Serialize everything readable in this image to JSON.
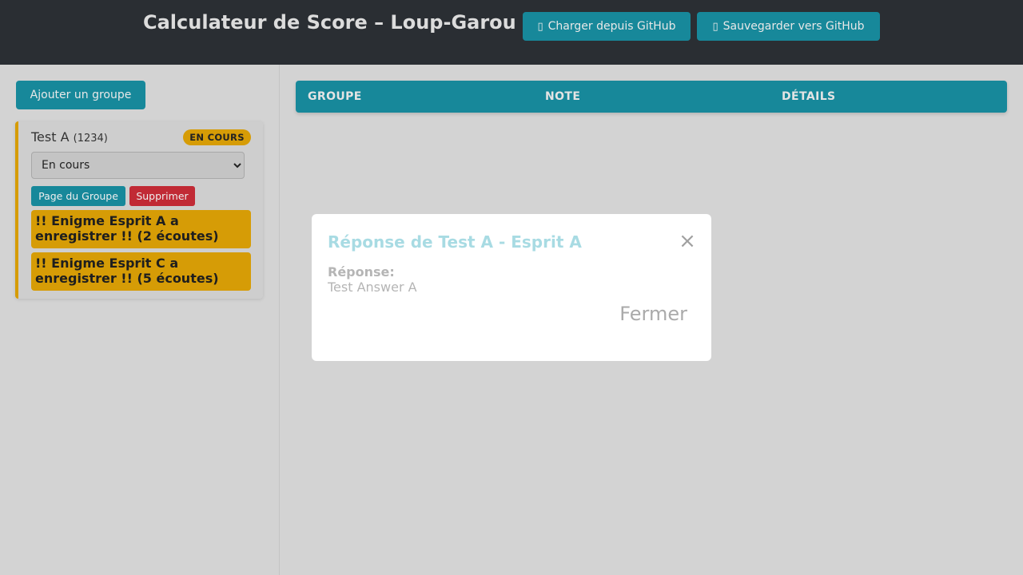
{
  "header": {
    "title": "Calculateur de Score – Loup-Garou",
    "load_button": {
      "icon": "github-icon",
      "label": "Charger depuis GitHub"
    },
    "save_button": {
      "icon": "github-icon",
      "label": "Sauvegarder vers GitHub"
    },
    "colors": {
      "background": "#2a2e33",
      "accent": "#17889a"
    }
  },
  "sidebar": {
    "add_group_label": "Ajouter un groupe",
    "groups": [
      {
        "name": "Test A",
        "code": "(1234)",
        "status_badge": "EN COURS",
        "status_select": {
          "selected": "En cours"
        },
        "buttons": {
          "page": "Page du Groupe",
          "delete": "Supprimer"
        },
        "alerts": [
          "!! Enigme Esprit A a enregistrer !! (2 écoutes)",
          "!! Enigme Esprit C a enregistrer !! (5 écoutes)"
        ]
      }
    ]
  },
  "main": {
    "table": {
      "columns": [
        "GROUPE",
        "NOTE",
        "DÉTAILS"
      ],
      "rows": []
    }
  },
  "modal": {
    "title": "Réponse de Test A - Esprit A",
    "answer_label": "Réponse:",
    "answer_value": "Test Answer A",
    "close_icon": "close-icon",
    "close_button": "Fermer"
  },
  "colors": {
    "warning": "#d69c06",
    "danger": "#c12a35",
    "page_background": "#d3d3d3"
  }
}
